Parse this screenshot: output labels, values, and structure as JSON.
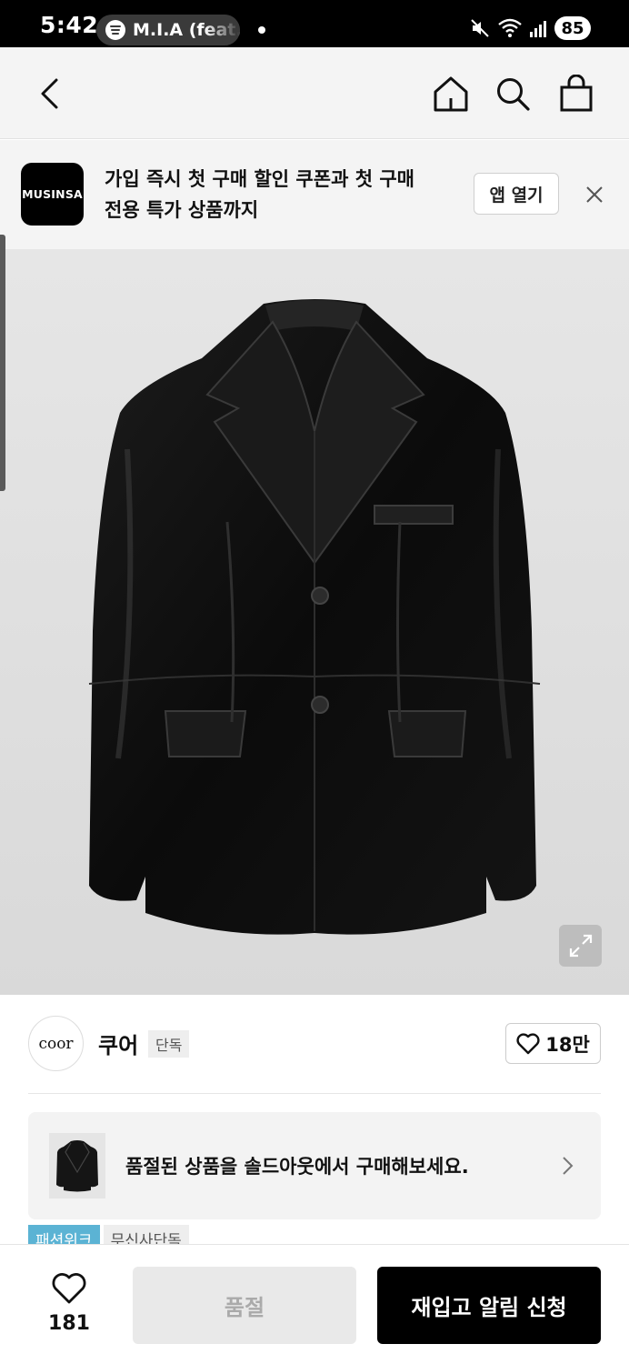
{
  "status_bar": {
    "time": "5:42",
    "media_title": "M.I.A (feat.",
    "battery": "85",
    "icons": [
      "spotify-icon",
      "mute-icon",
      "wifi-icon",
      "signal-icon"
    ]
  },
  "nav": {
    "icons": [
      "back-icon",
      "home-icon",
      "search-icon",
      "shopping-bag-icon"
    ]
  },
  "app_banner": {
    "logo_text": "MUSINSA",
    "line1": "가입 즉시 첫 구매 할인 쿠폰과 첫 구매",
    "line2": "전용 특가 상품까지",
    "open_label": "앱 열기",
    "close_icon": "close-icon"
  },
  "product": {
    "image_alt": "black leather jacket",
    "zoom_icon": "expand-icon"
  },
  "brand": {
    "logo_text": "coor",
    "name": "쿠어",
    "tag": "단독",
    "like_count": "18만"
  },
  "notice": {
    "text": "품절된 상품을 솔드아웃에서 구매해보세요."
  },
  "tags": [
    "패션위크",
    "무신사단독"
  ],
  "bottom_bar": {
    "like_count": "181",
    "soldout_label": "품절",
    "restock_label": "재입고 알림 신청"
  },
  "colors": {
    "brand_black": "#000000",
    "tag_blue": "#5bb3d4",
    "banner_bg": "#f4f4f4"
  }
}
